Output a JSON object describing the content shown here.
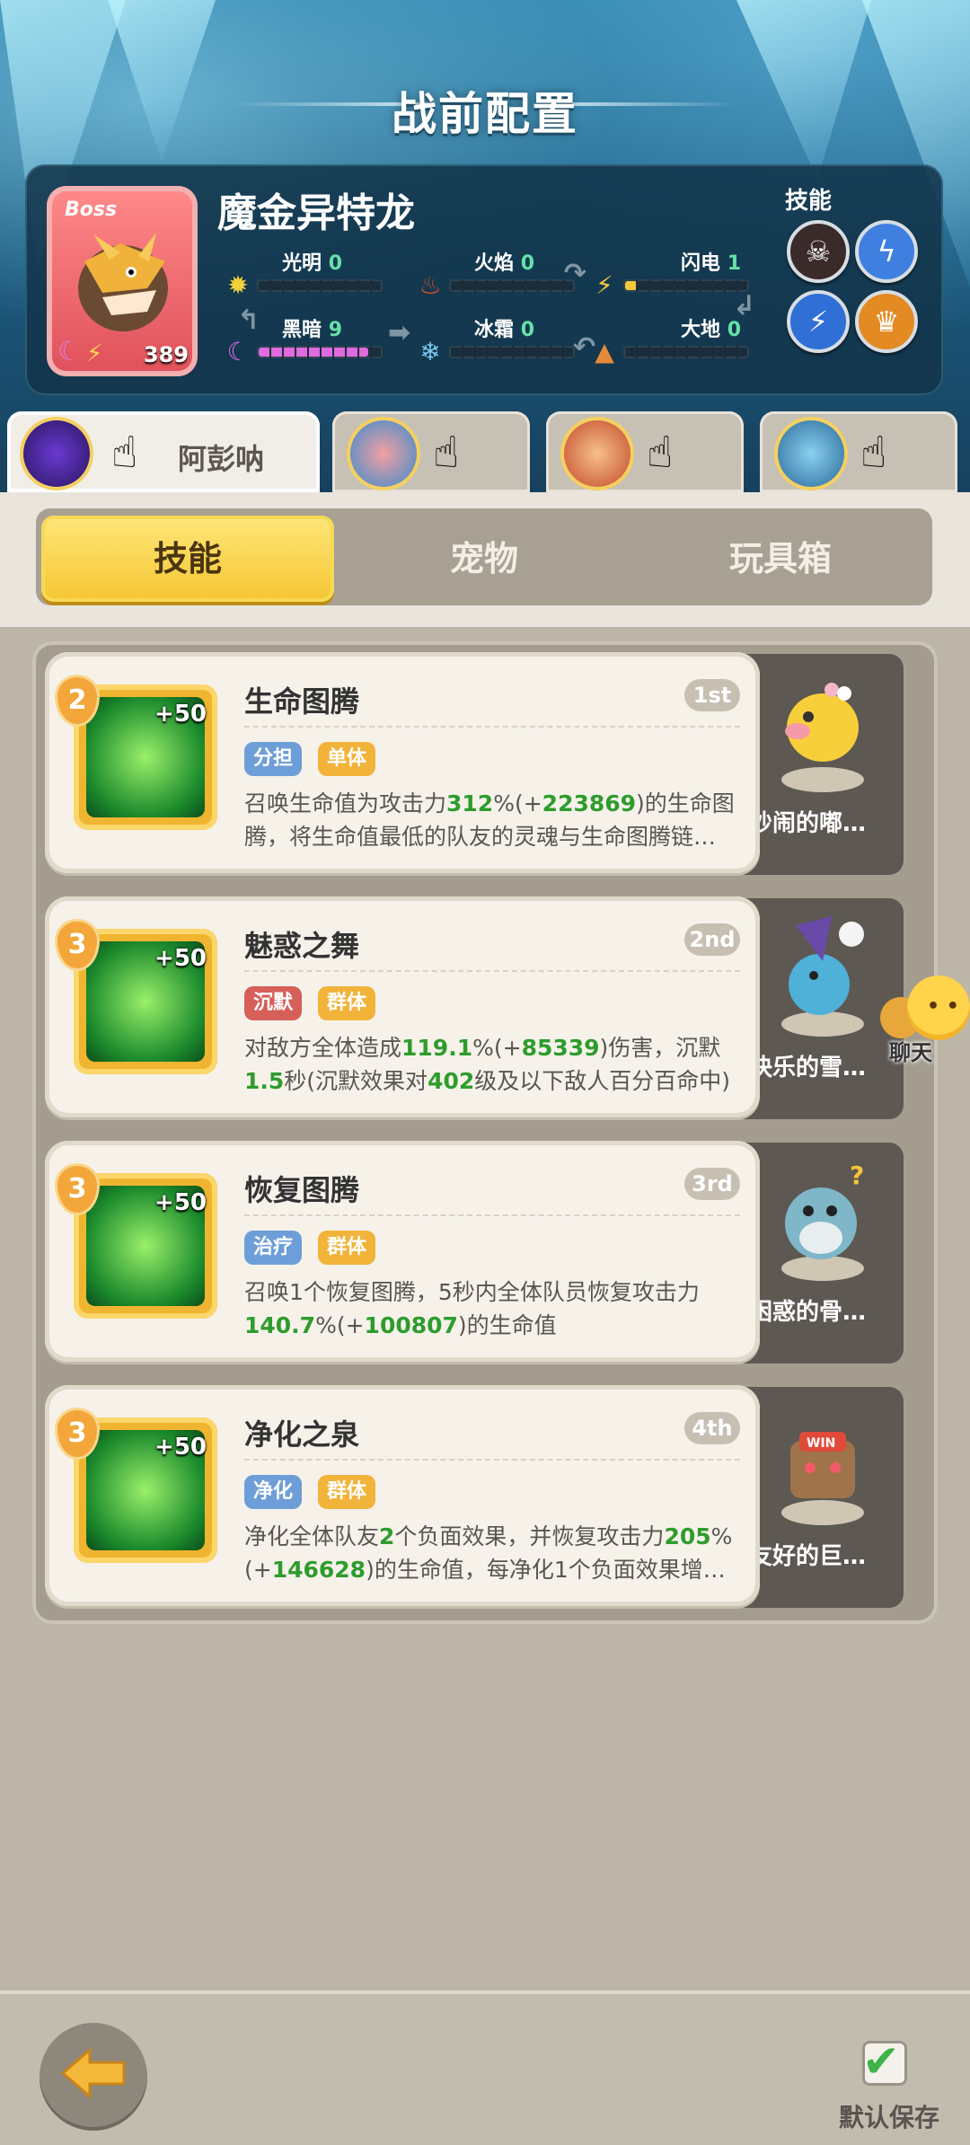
{
  "header": {
    "title": "战前配置"
  },
  "boss": {
    "tag": "Boss",
    "name": "魔金异特龙",
    "level": "389",
    "skills_label": "技能",
    "stats": [
      {
        "name": "光明",
        "value": "0",
        "icon": "sun-icon",
        "color": "#f2d03b",
        "fill": 0
      },
      {
        "name": "火焰",
        "value": "0",
        "icon": "flame-icon",
        "color": "#e04f2b",
        "fill": 0
      },
      {
        "name": "闪电",
        "value": "1",
        "icon": "lightning-icon",
        "color": "#f3c93a",
        "fill": 0.1
      },
      {
        "name": "黑暗",
        "value": "9",
        "icon": "moon-icon",
        "color": "#e06ae0",
        "fill": 0.9
      },
      {
        "name": "冰霜",
        "value": "0",
        "icon": "snowflake-icon",
        "color": "#79c8f0",
        "fill": 0
      },
      {
        "name": "大地",
        "value": "0",
        "icon": "mountain-icon",
        "color": "#e58a3a",
        "fill": 0
      }
    ],
    "skill_orbs": [
      {
        "icon": "monster-mouth-icon",
        "color": "#3a2a2a"
      },
      {
        "icon": "lightning-swirl-icon",
        "color": "#3e7fe0"
      },
      {
        "icon": "lightning-bolt-icon",
        "color": "#2f6fd6"
      },
      {
        "icon": "crown-fire-icon",
        "color": "#e38a23"
      }
    ]
  },
  "characters": [
    {
      "name": "阿彭呐",
      "active": true
    },
    {
      "name": "",
      "active": false
    },
    {
      "name": "",
      "active": false
    },
    {
      "name": "",
      "active": false
    }
  ],
  "tabs": [
    {
      "label": "技能",
      "active": true
    },
    {
      "label": "宠物",
      "active": false
    },
    {
      "label": "玩具箱",
      "active": false
    }
  ],
  "skills": [
    {
      "level": "2",
      "plus": "+50",
      "name": "生命图腾",
      "order": "1st",
      "tags": [
        {
          "text": "分担",
          "color": "blue"
        },
        {
          "text": "单体",
          "color": "orange"
        }
      ],
      "desc": [
        {
          "t": "召唤生命值为攻击力",
          "h": false
        },
        {
          "t": "312",
          "h": true
        },
        {
          "t": "%(+",
          "h": false
        },
        {
          "t": "223869",
          "h": true
        },
        {
          "t": ")的生命图腾，将生命值最低的队友的灵魂与生命图腾链…",
          "h": false
        }
      ],
      "pet": "吵闹的嘟…"
    },
    {
      "level": "3",
      "plus": "+50",
      "name": "魅惑之舞",
      "order": "2nd",
      "tags": [
        {
          "text": "沉默",
          "color": "red"
        },
        {
          "text": "群体",
          "color": "orange"
        }
      ],
      "desc": [
        {
          "t": "对敌方全体造成",
          "h": false
        },
        {
          "t": "119.1",
          "h": true
        },
        {
          "t": "%(+",
          "h": false
        },
        {
          "t": "85339",
          "h": true
        },
        {
          "t": ")伤害，沉默",
          "h": false
        },
        {
          "t": "1.5",
          "h": true
        },
        {
          "t": "秒(沉默效果对",
          "h": false
        },
        {
          "t": "402",
          "h": true
        },
        {
          "t": "级及以下敌人百分百命中)",
          "h": false
        }
      ],
      "pet": "快乐的雪…"
    },
    {
      "level": "3",
      "plus": "+50",
      "name": "恢复图腾",
      "order": "3rd",
      "tags": [
        {
          "text": "治疗",
          "color": "blue"
        },
        {
          "text": "群体",
          "color": "orange"
        }
      ],
      "desc": [
        {
          "t": "召唤1个恢复图腾，5秒内全体队员恢复攻击力",
          "h": false
        },
        {
          "t": "140.7",
          "h": true
        },
        {
          "t": "%(+",
          "h": false
        },
        {
          "t": "100807",
          "h": true
        },
        {
          "t": ")的生命值",
          "h": false
        }
      ],
      "pet": "困惑的骨…"
    },
    {
      "level": "3",
      "plus": "+50",
      "name": "净化之泉",
      "order": "4th",
      "tags": [
        {
          "text": "净化",
          "color": "blue"
        },
        {
          "text": "群体",
          "color": "orange"
        }
      ],
      "desc": [
        {
          "t": "净化全体队友",
          "h": false
        },
        {
          "t": "2",
          "h": true
        },
        {
          "t": "个负面效果，并恢复攻击力",
          "h": false
        },
        {
          "t": "205",
          "h": true
        },
        {
          "t": "%(+",
          "h": false
        },
        {
          "t": "146628",
          "h": true
        },
        {
          "t": ")的生命值，每净化1个负面效果增…",
          "h": false
        }
      ],
      "pet": "友好的巨…"
    }
  ],
  "chat": {
    "label": "聊天"
  },
  "footer": {
    "save_label": "默认保存"
  }
}
